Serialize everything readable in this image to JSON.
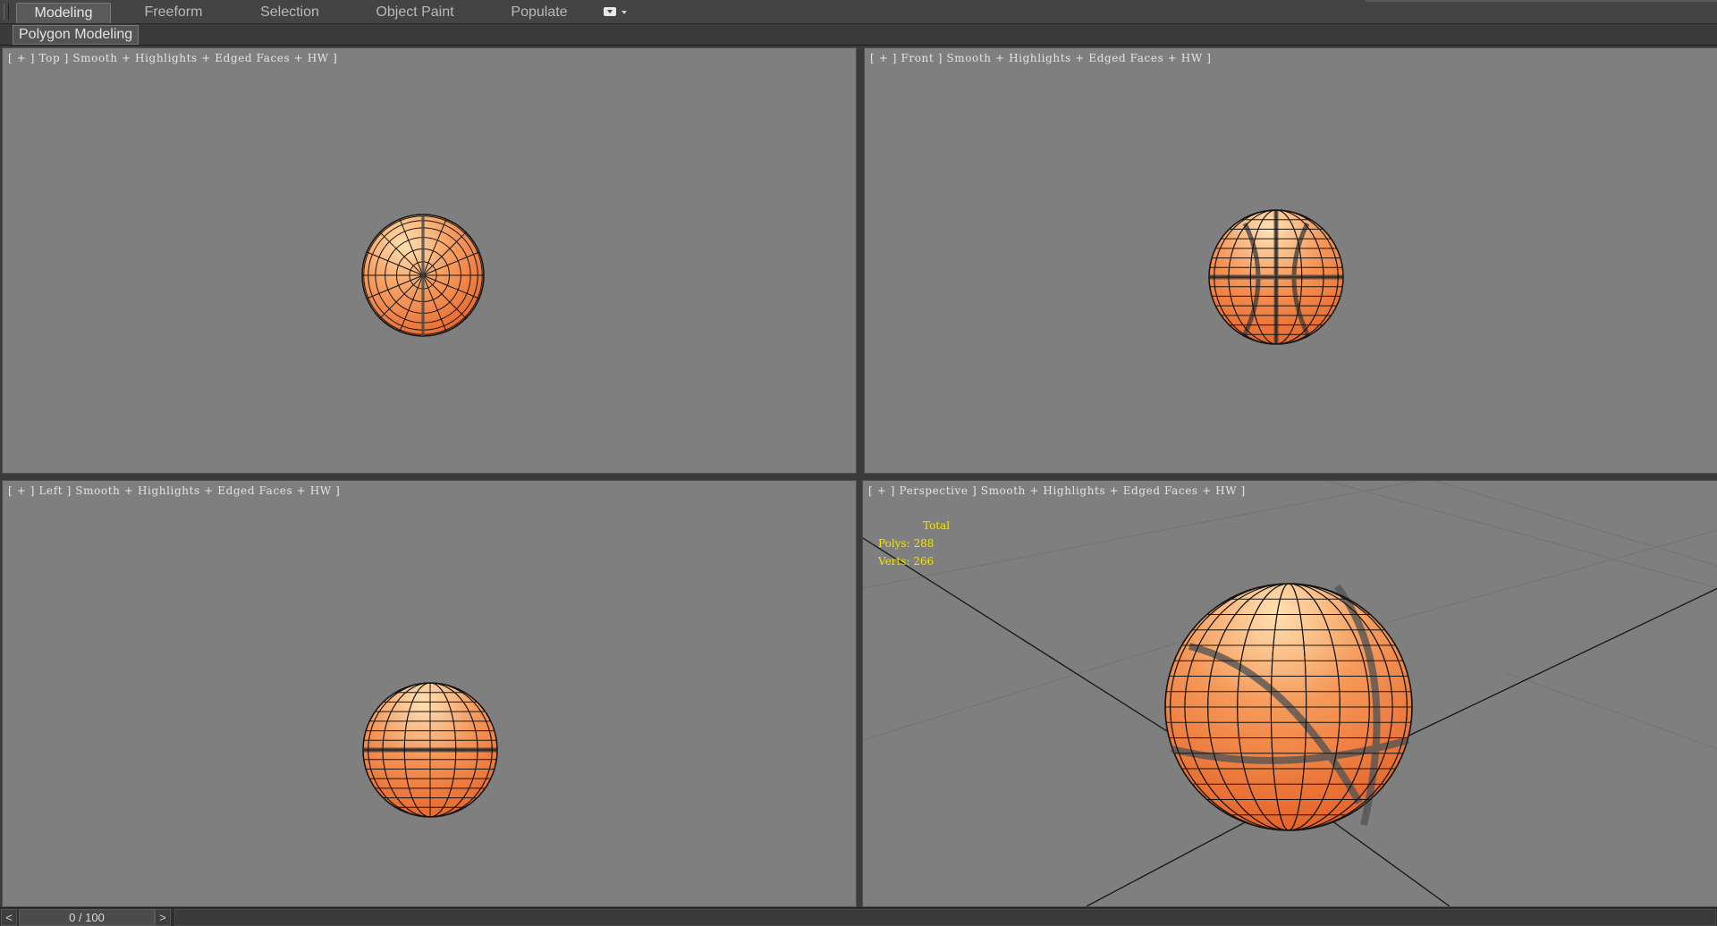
{
  "ribbon": {
    "tabs": [
      {
        "label": "Modeling",
        "active": true
      },
      {
        "label": "Freeform",
        "active": false
      },
      {
        "label": "Selection",
        "active": false
      },
      {
        "label": "Object Paint",
        "active": false
      },
      {
        "label": "Populate",
        "active": false
      }
    ],
    "panel_title": "Polygon Modeling"
  },
  "viewports": {
    "top": {
      "label": "[ + ] Top ] Smooth + Highlights + Edged Faces + HW ]"
    },
    "front": {
      "label": "[ + ] Front ] Smooth + Highlights + Edged Faces + HW ]"
    },
    "left": {
      "label": "[ + ] Left ] Smooth + Highlights + Edged Faces + HW ]"
    },
    "perspective": {
      "label": "[ + ] Perspective ] Smooth + Highlights + Edged Faces + HW ]"
    }
  },
  "stats": {
    "total_label": "Total",
    "polys": "Polys: 288",
    "verts": "Verts: 266"
  },
  "timeline": {
    "frame_display": "0 / 100",
    "prev_label": "<",
    "next_label": ">"
  },
  "colors": {
    "viewport_bg": "#7f7f7f",
    "ball_orange": "#f07a3a",
    "ball_highlight": "#ffd9a0",
    "wire": "#111111",
    "stats_text": "#f2e200"
  },
  "icons": {
    "ribbon_menu": "dropdown-icon",
    "object": "basketball-sphere"
  }
}
